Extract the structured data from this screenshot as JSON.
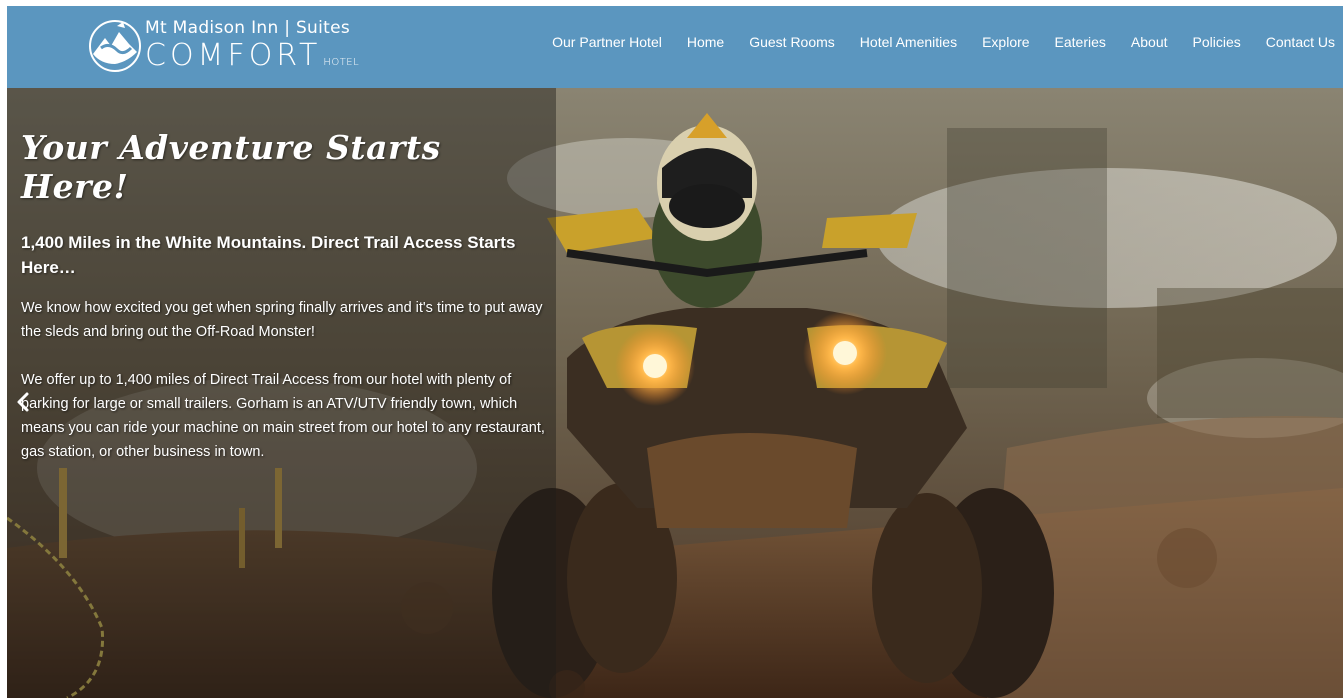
{
  "header": {
    "logo": {
      "line1": "Mt Madison Inn | Suites",
      "line2": "COMFORT",
      "line2_suffix": "HOTEL"
    },
    "nav": [
      {
        "label": "Our Partner Hotel"
      },
      {
        "label": "Home"
      },
      {
        "label": "Guest Rooms"
      },
      {
        "label": "Hotel Amenities"
      },
      {
        "label": "Explore"
      },
      {
        "label": "Eateries"
      },
      {
        "label": "About"
      },
      {
        "label": "Policies"
      },
      {
        "label": "Contact Us"
      }
    ]
  },
  "hero": {
    "title": "Your Adventure Starts Here!",
    "subhead": "1,400 Miles in the White Mountains. Direct Trail Access Starts Here…",
    "paragraphs": [
      "We know how excited you get when spring finally arrives and it's time to put away the sleds and bring out the Off-Road Monster!",
      "We offer up to 1,400 miles of Direct Trail Access from our hotel with plenty of parking for large or small trailers. Gorham is an ATV/UTV friendly town, which means you can ride your machine on main street from our hotel to any restaurant, gas station, or other business in town."
    ],
    "image": "atv-rider-mud-photo",
    "prev_icon": "chevron-left-icon"
  },
  "colors": {
    "header_bg": "#5b96bf",
    "text": "#ffffff"
  }
}
